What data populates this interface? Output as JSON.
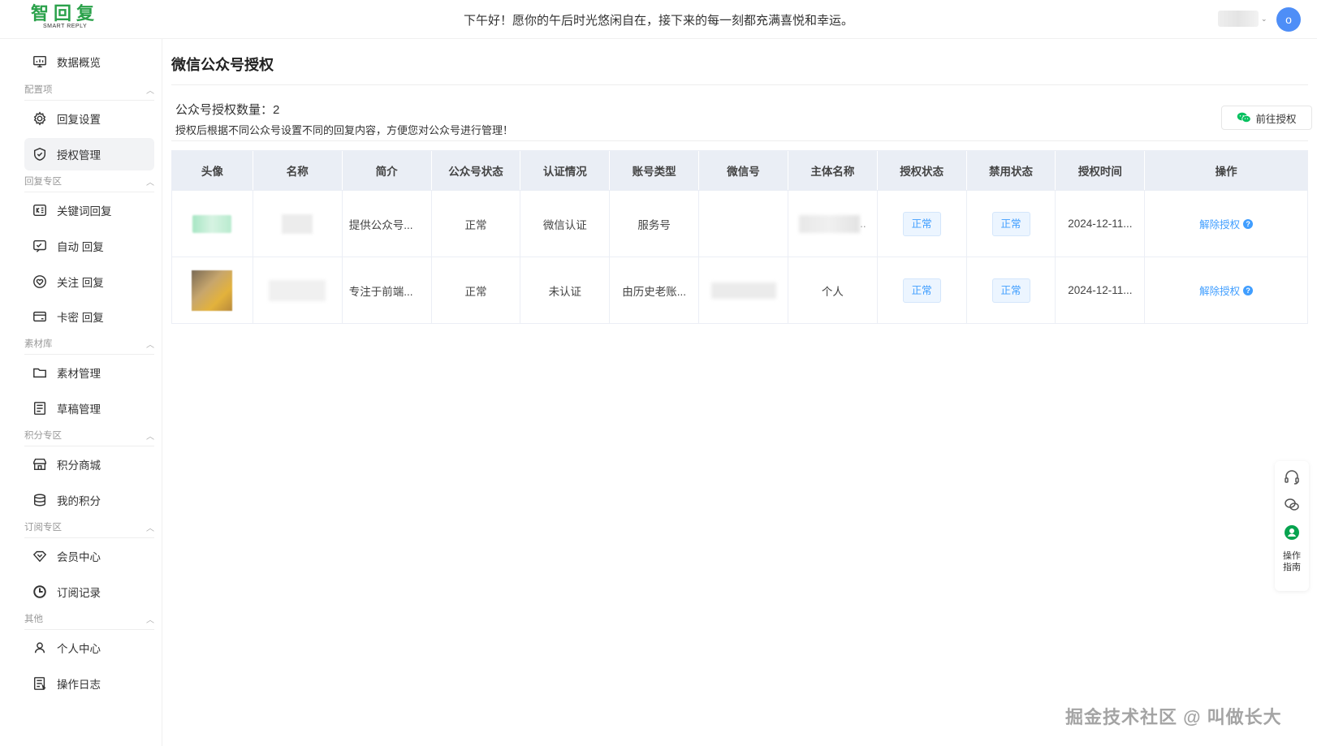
{
  "header": {
    "logo_text": "智回复",
    "logo_sub": "SMART REPLY",
    "greeting": "下午好！愿你的午后时光悠闲自在，接下来的每一刻都充满喜悦和幸运。",
    "avatar_letter": "o"
  },
  "sidebar": {
    "overview": "数据概览",
    "groups": {
      "config": "配置项",
      "reply": "回复专区",
      "material": "素材库",
      "points": "积分专区",
      "subscribe": "订阅专区",
      "other": "其他"
    },
    "items": {
      "reply_settings": "回复设置",
      "auth_manage": "授权管理",
      "keyword_reply": "关键词回复",
      "auto_reply": "自动 回复",
      "follow_reply": "关注 回复",
      "card_reply": "卡密 回复",
      "material_manage": "素材管理",
      "draft_manage": "草稿管理",
      "points_mall": "积分商城",
      "my_points": "我的积分",
      "member_center": "会员中心",
      "subscribe_record": "订阅记录",
      "personal_center": "个人中心",
      "operation_log": "操作日志"
    }
  },
  "main": {
    "title": "微信公众号授权",
    "count_label": "公众号授权数量：",
    "count_value": "2",
    "description": "授权后根据不同公众号设置不同的回复内容，方便您对公众号进行管理！",
    "auth_button": "前往授权"
  },
  "table": {
    "headers": [
      "头像",
      "名称",
      "简介",
      "公众号状态",
      "认证情况",
      "账号类型",
      "微信号",
      "主体名称",
      "授权状态",
      "禁用状态",
      "授权时间",
      "操作"
    ],
    "rows": [
      {
        "intro": "提供公众号...",
        "status": "正常",
        "verify": "微信认证",
        "type": "服务号",
        "auth_status": "正常",
        "disable_status": "正常",
        "auth_time": "2024-12-11...",
        "action": "解除授权"
      },
      {
        "intro": "专注于前端...",
        "status": "正常",
        "verify": "未认证",
        "type": "由历史老账...",
        "subject": "个人",
        "auth_status": "正常",
        "disable_status": "正常",
        "auth_time": "2024-12-11...",
        "action": "解除授权"
      }
    ]
  },
  "float_bar": {
    "guide_label": "操作指南"
  },
  "watermark": "掘金技术社区 @ 叫做长大"
}
